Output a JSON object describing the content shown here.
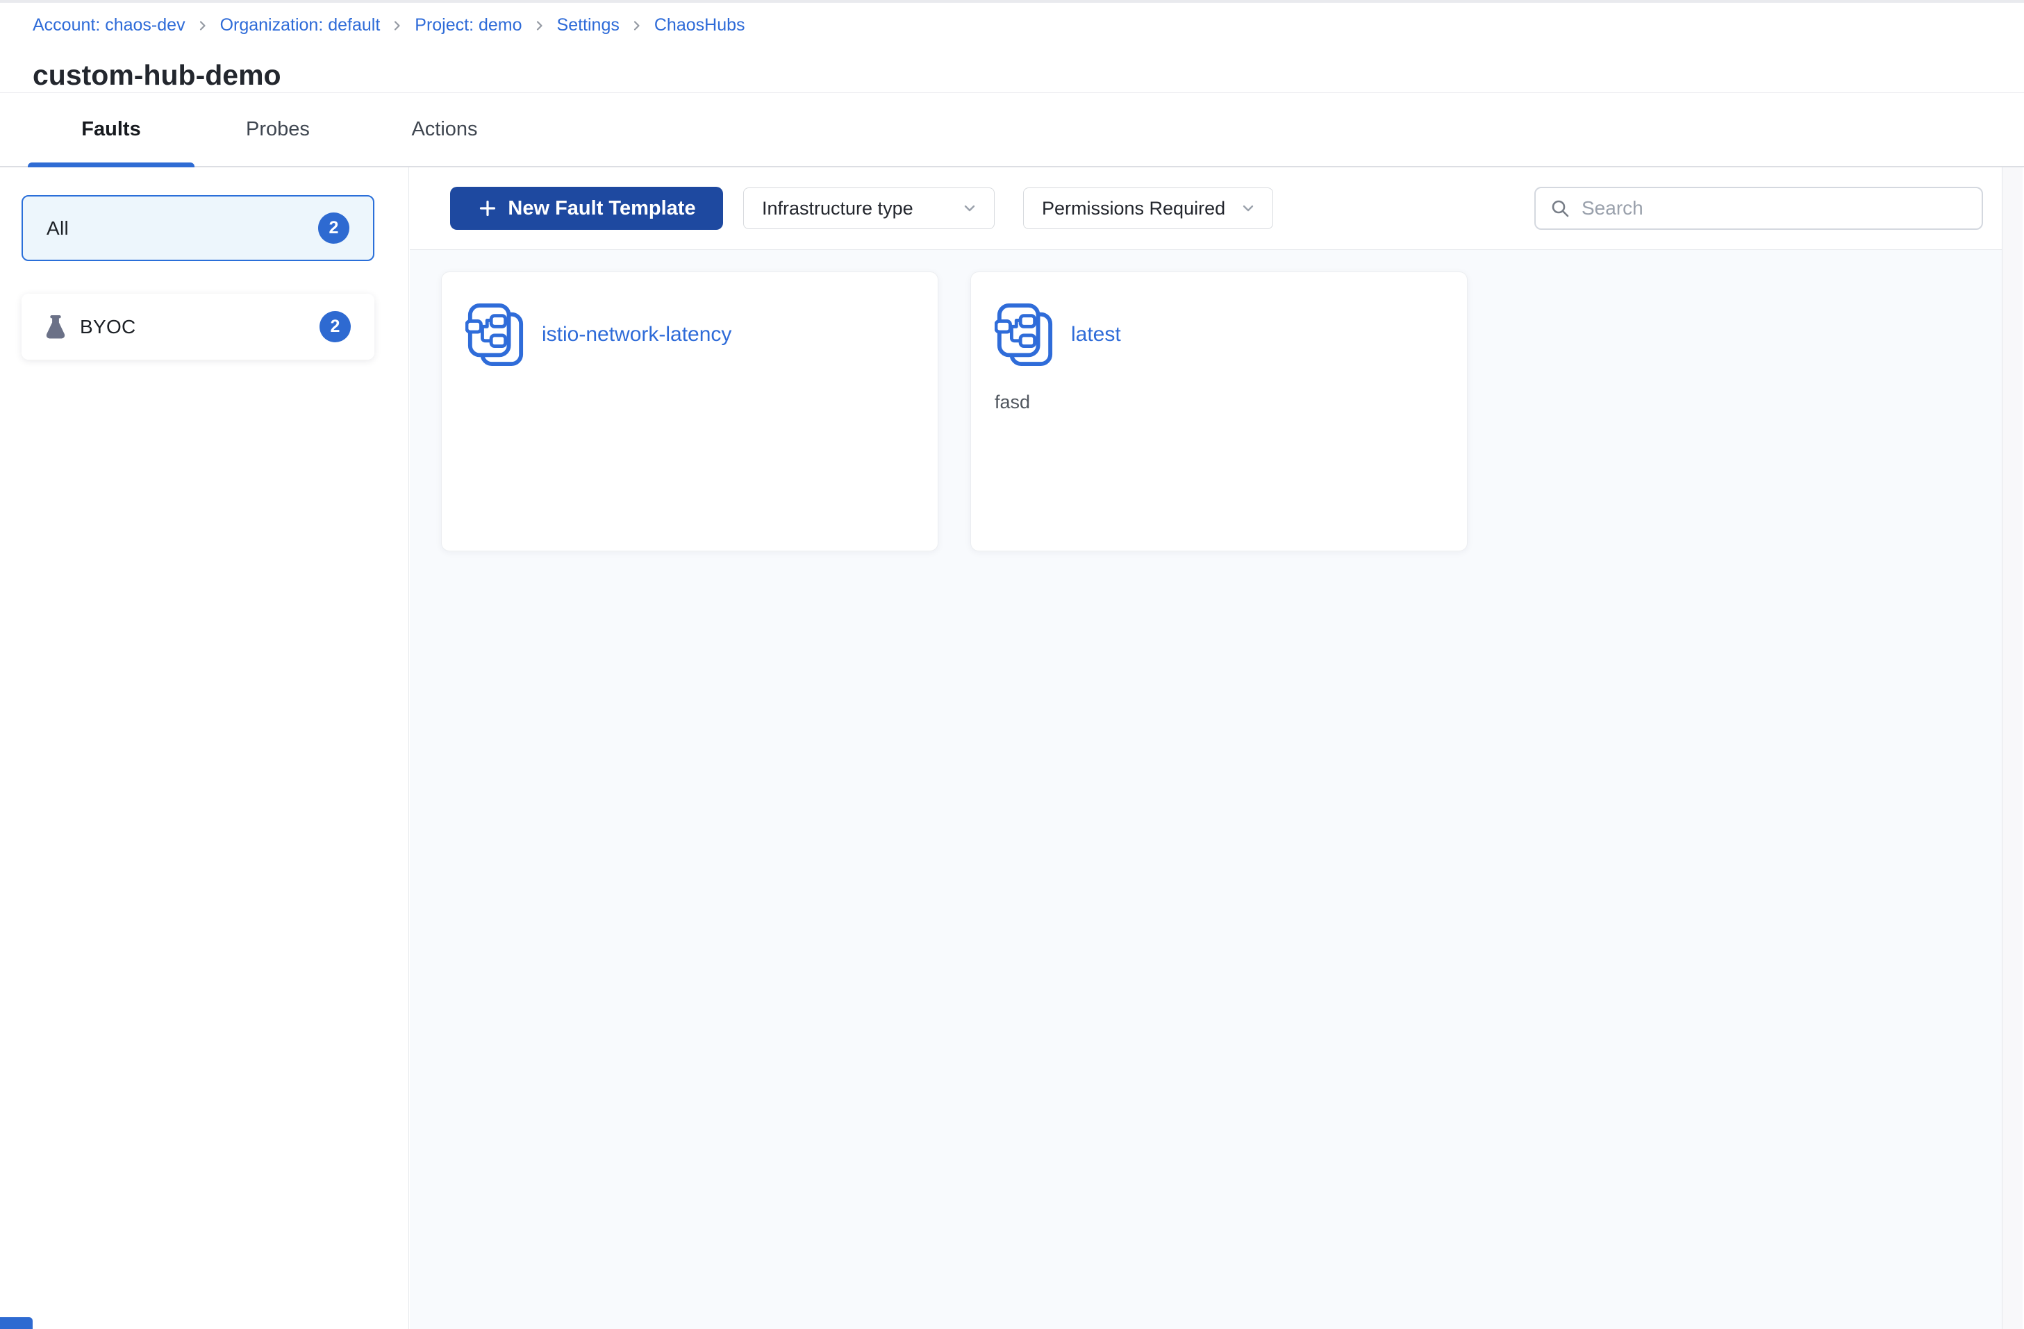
{
  "breadcrumb": {
    "items": [
      "Account: chaos-dev",
      "Organization: default",
      "Project: demo",
      "Settings",
      "ChaosHubs"
    ]
  },
  "page_title": "custom-hub-demo",
  "tabs": [
    {
      "label": "Faults",
      "active": true
    },
    {
      "label": "Probes",
      "active": false
    },
    {
      "label": "Actions",
      "active": false
    }
  ],
  "sidebar": {
    "items": [
      {
        "label": "All",
        "count": "2",
        "selected": true,
        "icon": null
      },
      {
        "label": "BYOC",
        "count": "2",
        "selected": false,
        "icon": "flask-icon"
      }
    ]
  },
  "toolbar": {
    "new_fault_template_label": "New Fault Template",
    "filters": [
      {
        "label": "Infrastructure type"
      },
      {
        "label": "Permissions Required"
      }
    ],
    "search": {
      "placeholder": "Search",
      "value": ""
    }
  },
  "cards": [
    {
      "title": "istio-network-latency",
      "description": ""
    },
    {
      "title": "latest",
      "description": "fasd"
    }
  ],
  "colors": {
    "primary_button": "#1e49a0",
    "link_blue": "#2e6bd8",
    "badge_blue": "#2e6ad1",
    "active_tab_underline": "#2f6cd4",
    "selected_item_bg": "#edf6fc",
    "selected_item_border": "#2a6fd9",
    "content_bg": "#f8fafd",
    "flask_icon_gray": "#6b7187"
  }
}
